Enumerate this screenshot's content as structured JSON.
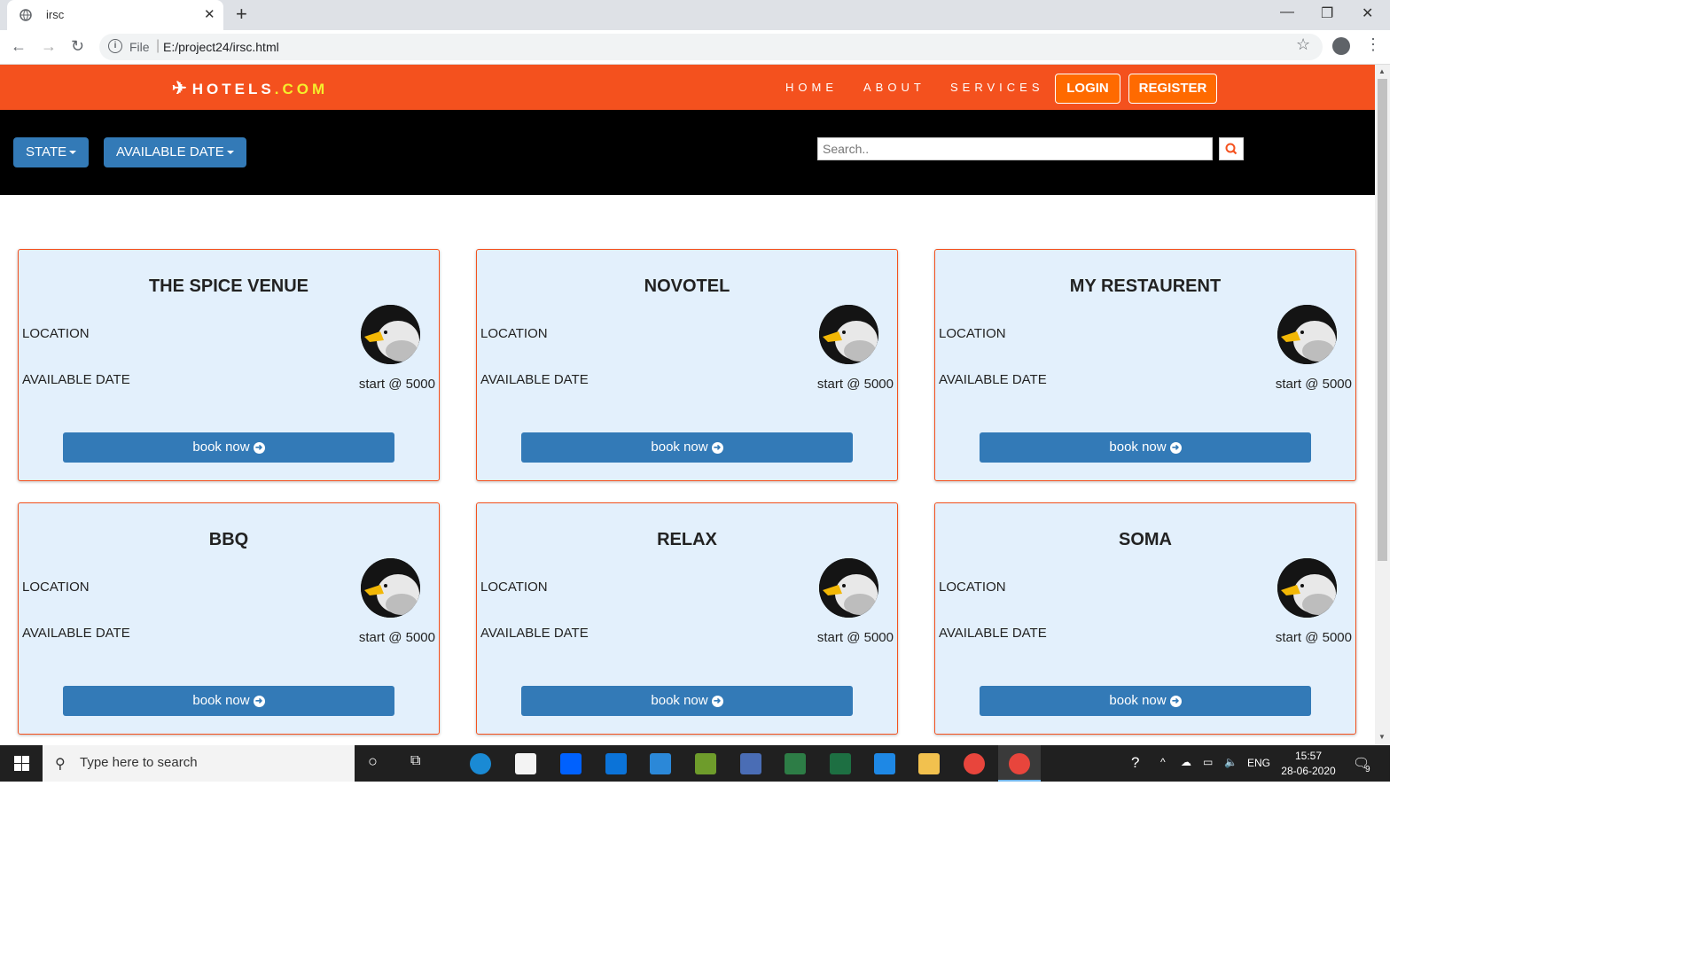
{
  "browser": {
    "tab_title": "irsc",
    "scheme_label": "File",
    "url": "E:/project24/irsc.html"
  },
  "site": {
    "logo_text": "HOTELS",
    "logo_tld": ".COM",
    "nav": {
      "home": "HOME",
      "about": "ABOUT",
      "services": "SERVICES",
      "login": "LOGIN",
      "register": "REGISTER"
    },
    "filters": {
      "state_label": "STATE",
      "date_label": "AVAILABLE DATE",
      "search_placeholder": "Search.."
    },
    "cards": [
      {
        "title": "THE SPICE VENUE",
        "location_label": "LOCATION",
        "date_label": "AVAILABLE DATE",
        "price": "start @ 5000",
        "button": "book now"
      },
      {
        "title": "NOVOTEL",
        "location_label": "LOCATION",
        "date_label": "AVAILABLE DATE",
        "price": "start @ 5000",
        "button": "book now"
      },
      {
        "title": "MY RESTAURENT",
        "location_label": "LOCATION",
        "date_label": "AVAILABLE DATE",
        "price": "start @ 5000",
        "button": "book now"
      },
      {
        "title": "BBQ",
        "location_label": "LOCATION",
        "date_label": "AVAILABLE DATE",
        "price": "start @ 5000",
        "button": "book now"
      },
      {
        "title": "RELAX",
        "location_label": "LOCATION",
        "date_label": "AVAILABLE DATE",
        "price": "start @ 5000",
        "button": "book now"
      },
      {
        "title": "SOMA",
        "location_label": "LOCATION",
        "date_label": "AVAILABLE DATE",
        "price": "start @ 5000",
        "button": "book now"
      }
    ]
  },
  "taskbar": {
    "search_placeholder": "Type here to search",
    "language": "ENG",
    "time": "15:57",
    "date": "28-06-2020",
    "notification_count": "9"
  },
  "colors": {
    "header_orange": "#f4511e",
    "button_blue": "#337ab7",
    "card_bg": "#e3f0fc",
    "logo_accent": "#f5ee2c"
  }
}
